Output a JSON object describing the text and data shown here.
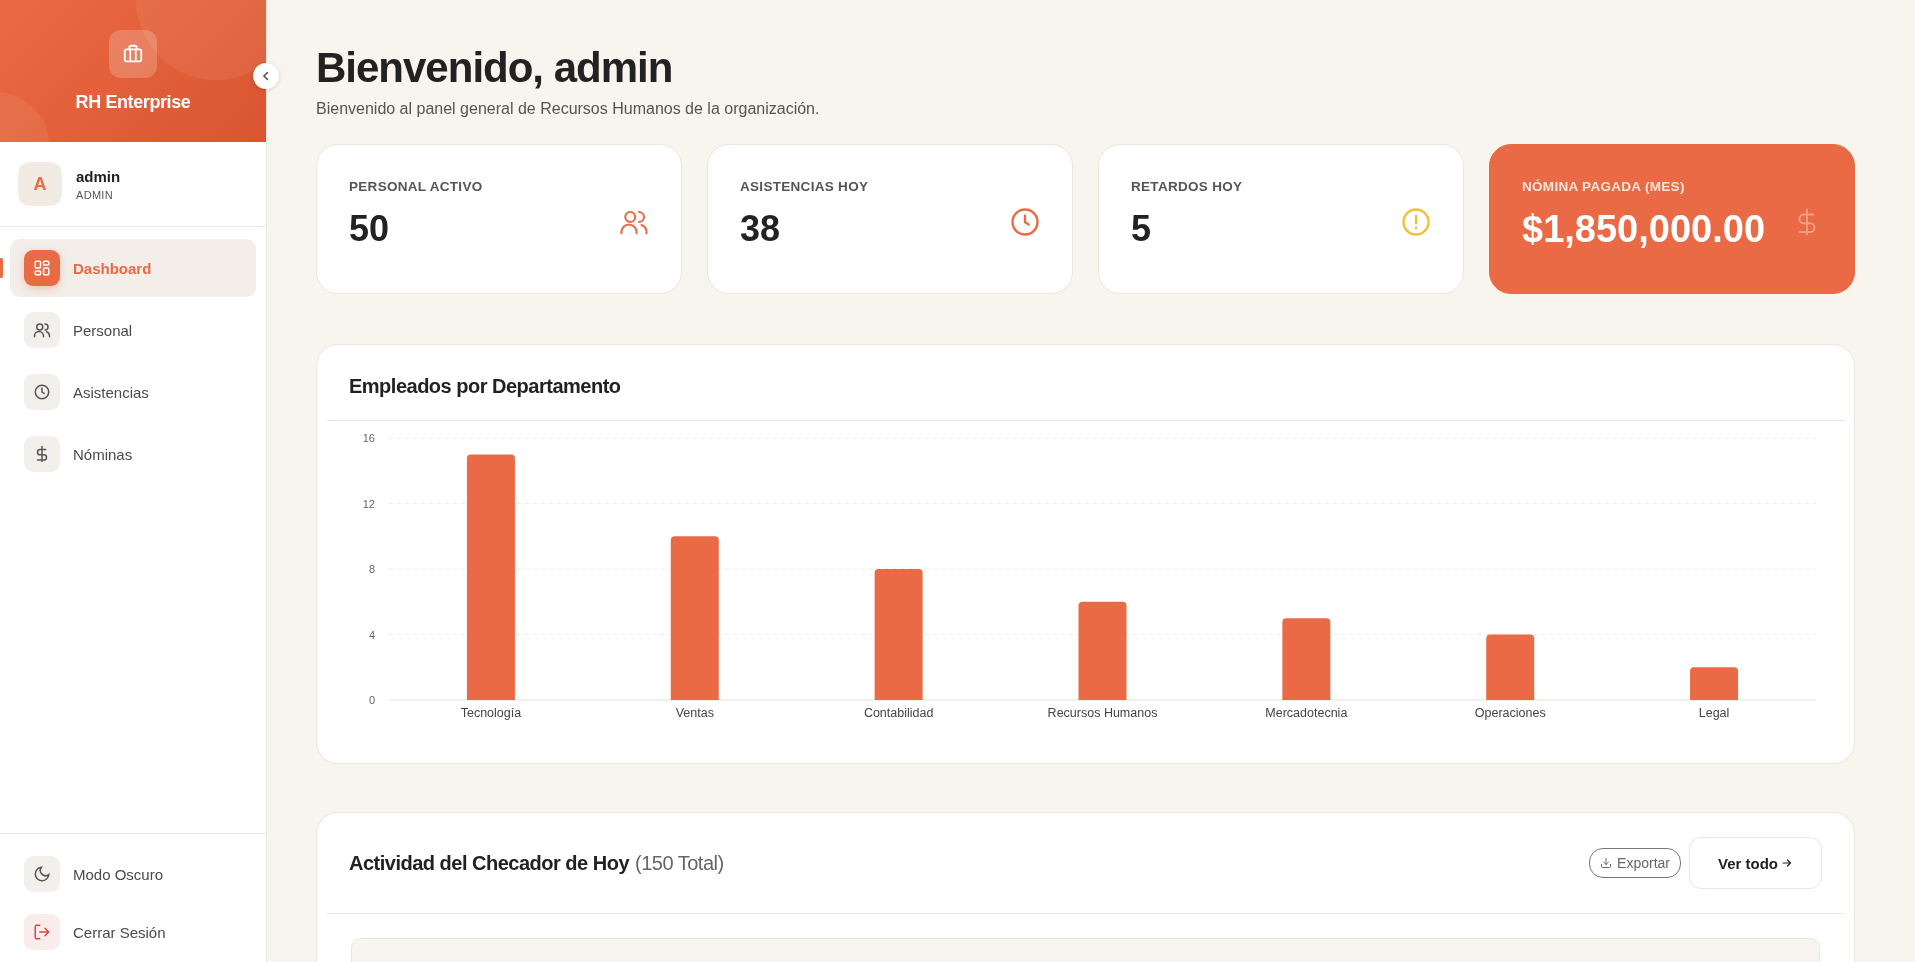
{
  "sidebar": {
    "brand": "RH Enterprise",
    "user": {
      "initial": "A",
      "name": "admin",
      "role": "ADMIN"
    },
    "items": [
      {
        "label": "Dashboard",
        "selected": true
      },
      {
        "label": "Personal",
        "selected": false
      },
      {
        "label": "Asistencias",
        "selected": false
      },
      {
        "label": "Nóminas",
        "selected": false
      }
    ],
    "footer_items": [
      {
        "label": "Modo Oscuro",
        "kind": "theme"
      },
      {
        "label": "Cerrar Sesión",
        "kind": "logout"
      }
    ]
  },
  "header": {
    "title": "Bienvenido, admin",
    "subtitle": "Bienvenido al panel general de Recursos Humanos de la organización."
  },
  "stats": [
    {
      "label": "PERSONAL ACTIVO",
      "value": "50",
      "highlight": false,
      "color": "#e96a45"
    },
    {
      "label": "ASISTENCIAS HOY",
      "value": "38",
      "highlight": false,
      "color": "#e96a45"
    },
    {
      "label": "RETARDOS HOY",
      "value": "5",
      "highlight": false,
      "color": "#f2c230"
    },
    {
      "label": "NÓMINA PAGADA (MES)",
      "value": "$1,850,000.00",
      "highlight": true
    }
  ],
  "department_chart": {
    "chart_data": {
      "type": "bar",
      "title": "Empleados por Departamento",
      "categories": [
        "Tecnología",
        "Ventas",
        "Contabilidad",
        "Recursos Humanos",
        "Mercadotecnia",
        "Operaciones",
        "Legal"
      ],
      "values": [
        15,
        10,
        8,
        6,
        5,
        4,
        2
      ],
      "color": "#e96a45",
      "ylim": [
        0,
        16
      ],
      "yticks": [
        0,
        4,
        8,
        12,
        16
      ],
      "grid": true
    }
  },
  "activity": {
    "title": "Actividad del Checador de Hoy",
    "count": "(150 Total)",
    "export_button": "Exportar",
    "view_all_button": "Ver todo"
  }
}
